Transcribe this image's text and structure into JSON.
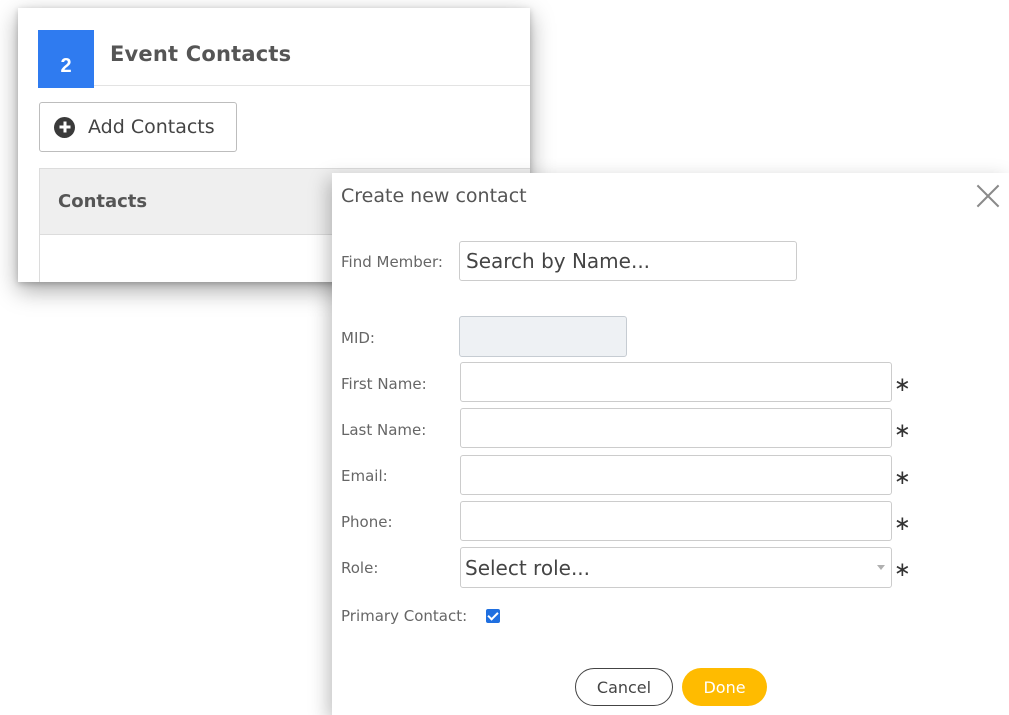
{
  "section": {
    "step_number": "2",
    "title": "Event Contacts",
    "add_button_label": "Add Contacts",
    "table_header": "Contacts"
  },
  "modal": {
    "title": "Create new contact",
    "find_member_label": "Find Member:",
    "find_member_placeholder": "Search by Name...",
    "fields": {
      "mid_label": "MID:",
      "first_name_label": "First Name:",
      "last_name_label": "Last Name:",
      "email_label": "Email:",
      "phone_label": "Phone:",
      "role_label": "Role:",
      "primary_contact_label": "Primary Contact:"
    },
    "required_marker": "∗",
    "role_placeholder": "Select role...",
    "primary_contact_checked": true,
    "cancel_label": "Cancel",
    "done_label": "Done"
  },
  "colors": {
    "accent_blue": "#2f7bf0",
    "done_yellow": "#ffbb00",
    "checkbox_blue": "#1f6fe0"
  }
}
